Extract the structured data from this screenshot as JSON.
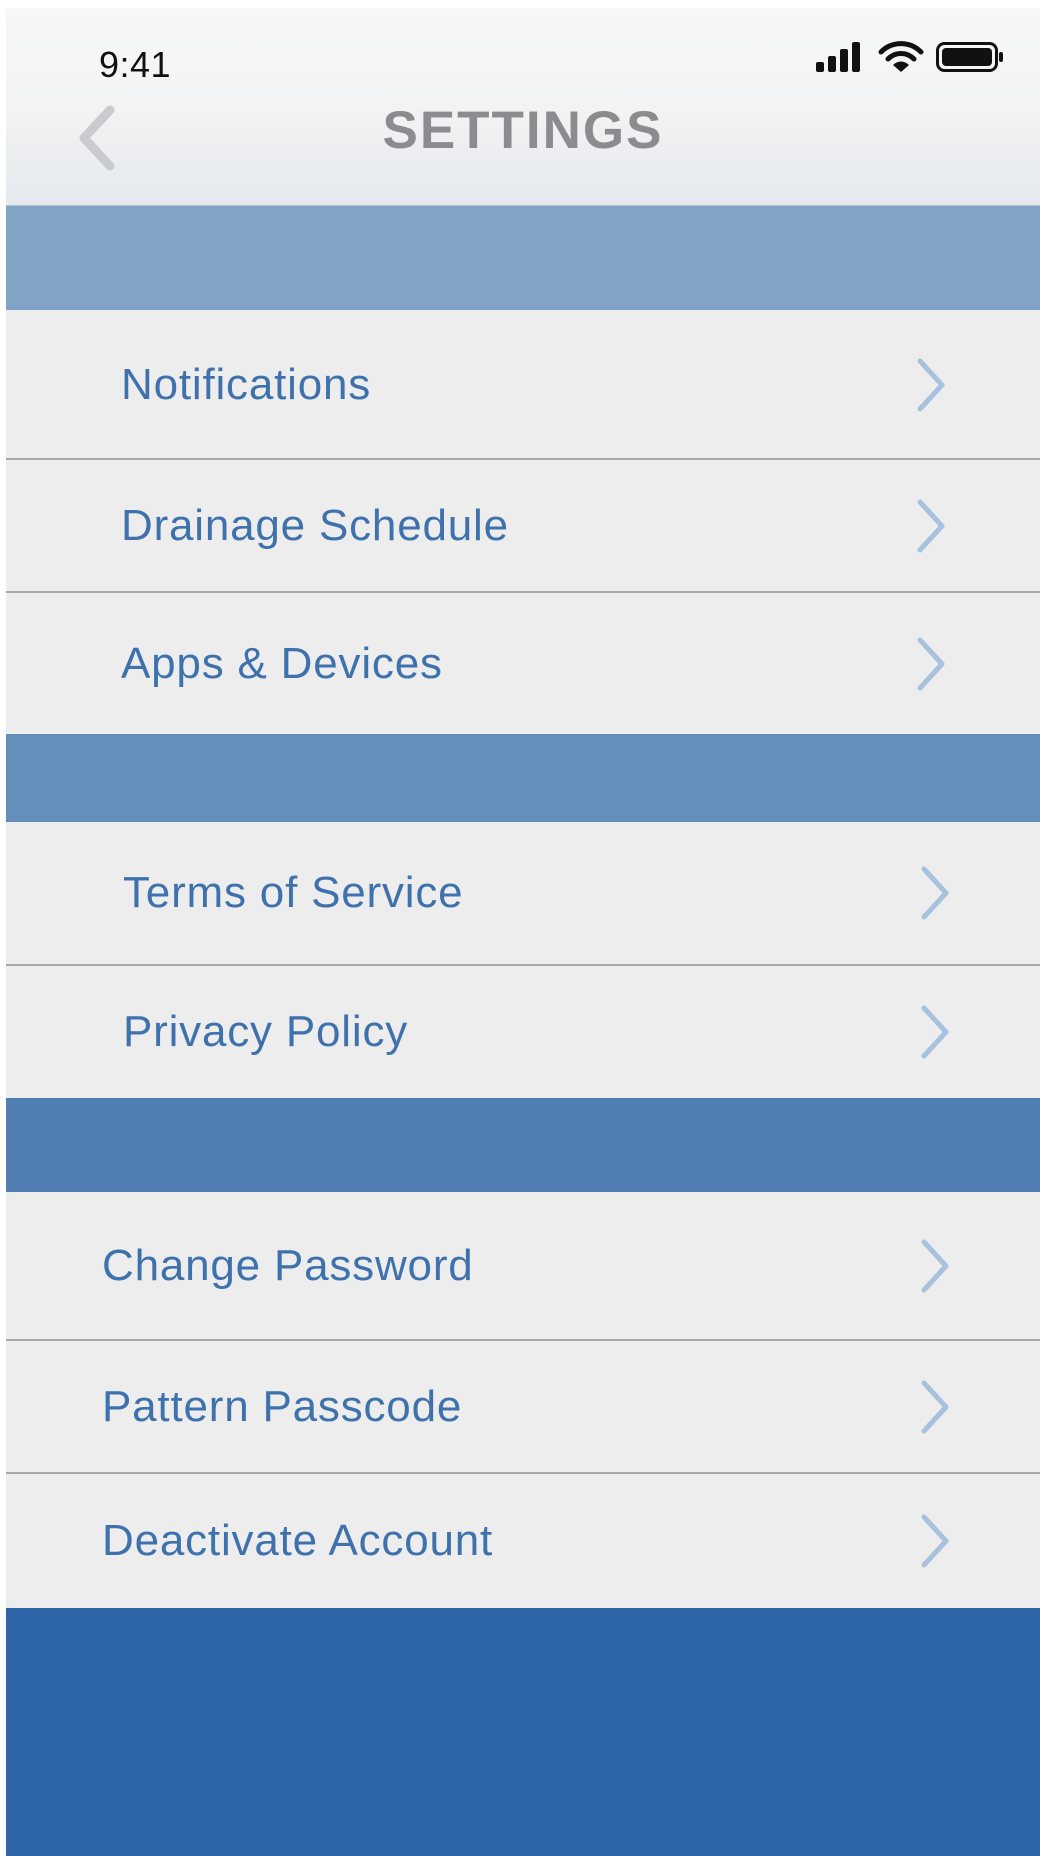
{
  "status_bar": {
    "time": "9:41",
    "icons": [
      "cellular-signal-icon",
      "wifi-icon",
      "battery-icon"
    ]
  },
  "header": {
    "title": "SETTINGS",
    "back_icon": "chevron-left-icon"
  },
  "colors": {
    "accent_text": "#3f72ad",
    "row_background": "#ededee",
    "section_1": "#80a3c6",
    "section_2": "#648fbb",
    "section_3": "#517fb3",
    "footer": "#2e66a7",
    "chevron": "#a8c1dc",
    "title": "#8a8c8f"
  },
  "sections": [
    {
      "items": [
        {
          "label": "Notifications",
          "icon": "chevron-right-icon"
        },
        {
          "label": "Drainage Schedule",
          "icon": "chevron-right-icon"
        },
        {
          "label": "Apps & Devices",
          "icon": "chevron-right-icon"
        }
      ]
    },
    {
      "items": [
        {
          "label": "Terms of Service",
          "icon": "chevron-right-icon"
        },
        {
          "label": "Privacy Policy",
          "icon": "chevron-right-icon"
        }
      ]
    },
    {
      "items": [
        {
          "label": "Change Password",
          "icon": "chevron-right-icon"
        },
        {
          "label": "Pattern Passcode",
          "icon": "chevron-right-icon"
        },
        {
          "label": "Deactivate Account",
          "icon": "chevron-right-icon"
        }
      ]
    }
  ]
}
